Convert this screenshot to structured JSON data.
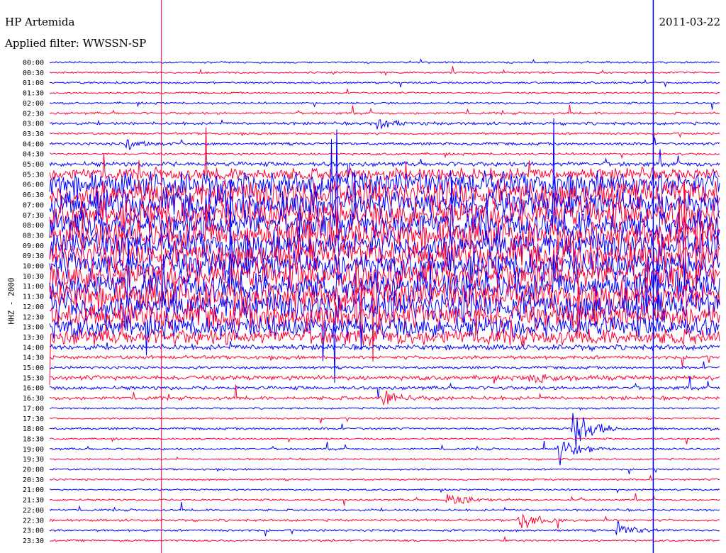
{
  "header": {
    "station": "HP Artemida",
    "filter": "Applied filter: WWSSN-SP",
    "date": "2011-03-22",
    "channel": "HHZ - 2000"
  },
  "chart_data": {
    "type": "line",
    "title": "HP Artemida",
    "subtitle": "Applied filter: WWSSN-SP",
    "date": "2011-03-22",
    "ylabel": "HHZ - 2000",
    "row_labels": [
      "00:00",
      "00:30",
      "01:00",
      "01:30",
      "02:00",
      "02:30",
      "03:00",
      "03:30",
      "04:00",
      "04:30",
      "05:00",
      "05:30",
      "06:00",
      "06:30",
      "07:00",
      "07:30",
      "08:00",
      "08:30",
      "09:00",
      "09:30",
      "10:00",
      "10:30",
      "11:00",
      "11:30",
      "12:00",
      "12:30",
      "13:00",
      "13:30",
      "14:00",
      "14:30",
      "15:00",
      "15:30",
      "16:00",
      "16:30",
      "17:00",
      "17:30",
      "18:00",
      "18:30",
      "19:00",
      "19:30",
      "20:00",
      "20:30",
      "21:00",
      "21:30",
      "22:00",
      "22:30",
      "23:00",
      "23:30"
    ],
    "trace_colors": [
      "#0000ff",
      "#ff0033"
    ],
    "row_amplitude": [
      1,
      1,
      1,
      1,
      1.2,
      1.3,
      1.6,
      1.2,
      1.5,
      1.3,
      2.5,
      7,
      14,
      16,
      16,
      16,
      16,
      16,
      16,
      16,
      16,
      16,
      16,
      16,
      16,
      14,
      12,
      9,
      3,
      2,
      1.5,
      2.5,
      2,
      2,
      1,
      1,
      1.2,
      1,
      1.2,
      1,
      1,
      1,
      1,
      1.1,
      1.2,
      1.3,
      1.2,
      1.1
    ],
    "events": [
      {
        "row": 6,
        "minute": 14.8,
        "amplitude": 9
      },
      {
        "row": 8,
        "minute": 3.5,
        "amplitude": 8
      },
      {
        "row": 31,
        "minute": 21.6,
        "amplitude": 12
      },
      {
        "row": 33,
        "minute": 15.0,
        "amplitude": 14
      },
      {
        "row": 36,
        "minute": 23.5,
        "amplitude": 40
      },
      {
        "row": 38,
        "minute": 22.8,
        "amplitude": 30
      },
      {
        "row": 43,
        "minute": 17.8,
        "amplitude": 16
      },
      {
        "row": 45,
        "minute": 21.0,
        "amplitude": 18
      },
      {
        "row": 46,
        "minute": 25.5,
        "amplitude": 12
      }
    ],
    "vertical_markers_minutes": [
      5.0,
      27.0
    ],
    "grid": false
  }
}
